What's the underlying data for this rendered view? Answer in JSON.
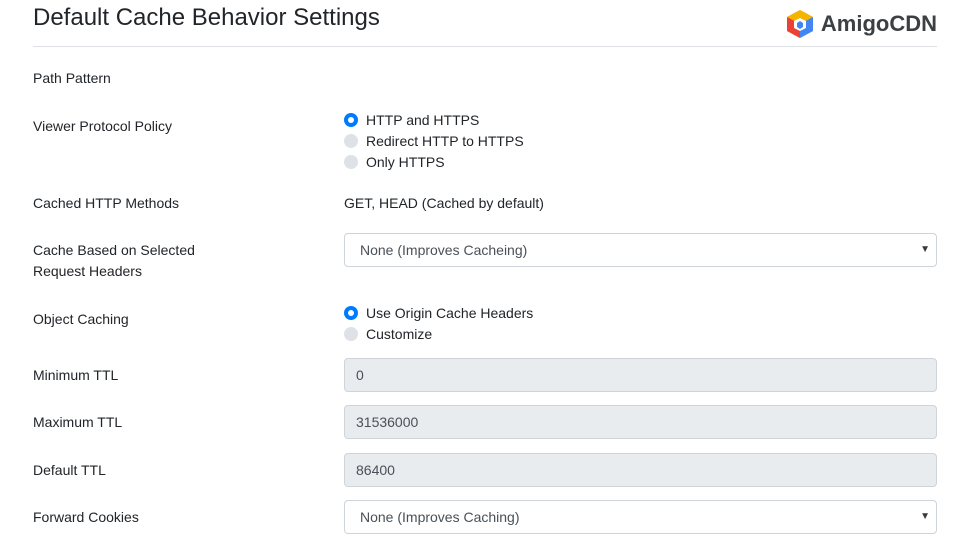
{
  "header": {
    "title": "Default Cache Behavior Settings",
    "brand_name": "AmigoCDN",
    "brand_logo_icon": "hexagon-cube-icon",
    "brand_colors": [
      "#f4b400",
      "#ea4335",
      "#4285f4",
      "#fbbc05"
    ]
  },
  "form": {
    "path_pattern": {
      "label": "Path Pattern"
    },
    "viewer_protocol_policy": {
      "label": "Viewer Protocol Policy",
      "options": [
        "HTTP and HTTPS",
        "Redirect HTTP to HTTPS",
        "Only HTTPS"
      ],
      "selected": "HTTP and HTTPS"
    },
    "cached_http_methods": {
      "label": "Cached HTTP Methods",
      "value": "GET, HEAD (Cached by default)"
    },
    "cache_based_on_headers": {
      "label_line1": "Cache Based on Selected",
      "label_line2": "Request Headers",
      "value": "None (Improves Cacheing)"
    },
    "object_caching": {
      "label": "Object Caching",
      "options": [
        "Use Origin Cache Headers",
        "Customize"
      ],
      "selected": "Use Origin Cache Headers"
    },
    "minimum_ttl": {
      "label": "Minimum TTL",
      "value": "0"
    },
    "maximum_ttl": {
      "label": "Maximum TTL",
      "value": "31536000"
    },
    "default_ttl": {
      "label": "Default TTL",
      "value": "86400"
    },
    "forward_cookies": {
      "label": "Forward Cookies",
      "value": "None (Improves Caching)"
    }
  },
  "colors": {
    "accent": "#007bff",
    "disabled_bg": "#e9ecef",
    "border": "#ced4da"
  }
}
